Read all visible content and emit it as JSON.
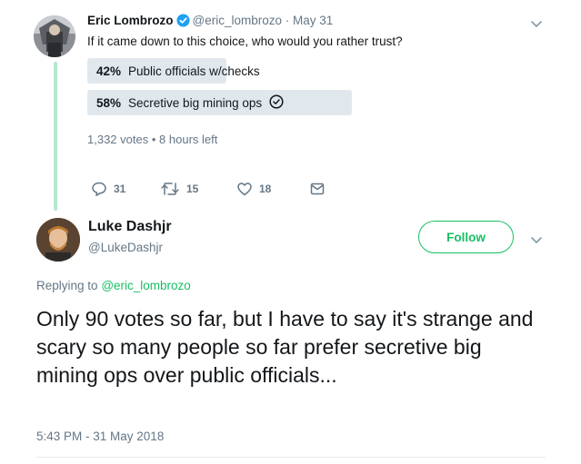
{
  "colors": {
    "accent": "#17bf63",
    "thread_line": "#b4e7cf",
    "poll_fill": "#e1e8ed",
    "secondary_text": "#657786",
    "verified_badge": "#1da1f2"
  },
  "tweet": {
    "author_name": "Eric Lombrozo",
    "verified": true,
    "handle": "@eric_lombrozo",
    "dot": "·",
    "date": "May 31",
    "text": "If it came down to this choice, who would you rather trust?",
    "poll": {
      "options": [
        {
          "percent_label": "42%",
          "percent": 42,
          "label": "Public officials w/checks",
          "selected": false
        },
        {
          "percent_label": "58%",
          "percent": 58,
          "label": "Secretive big mining ops",
          "selected": true
        }
      ],
      "votes": "1,332 votes",
      "separator": "•",
      "time_left": "8 hours left"
    },
    "actions": {
      "replies": "31",
      "retweets": "15",
      "likes": "18"
    }
  },
  "reply": {
    "author_name": "Luke Dashjr",
    "handle": "@LukeDashjr",
    "follow_label": "Follow",
    "replying_prefix": "Replying to",
    "replying_to": "@eric_lombrozo",
    "text": "Only 90 votes so far, but I have to say it's strange and scary so many people so far prefer secretive big mining ops over public officials...",
    "timestamp": "5:43 PM - 31 May 2018"
  },
  "icons": {
    "chevron": "chevron-down-icon",
    "reply": "reply-icon",
    "retweet": "retweet-icon",
    "like": "heart-icon",
    "dm": "envelope-icon",
    "check": "check-circle-icon",
    "verified": "verified-badge-icon"
  }
}
